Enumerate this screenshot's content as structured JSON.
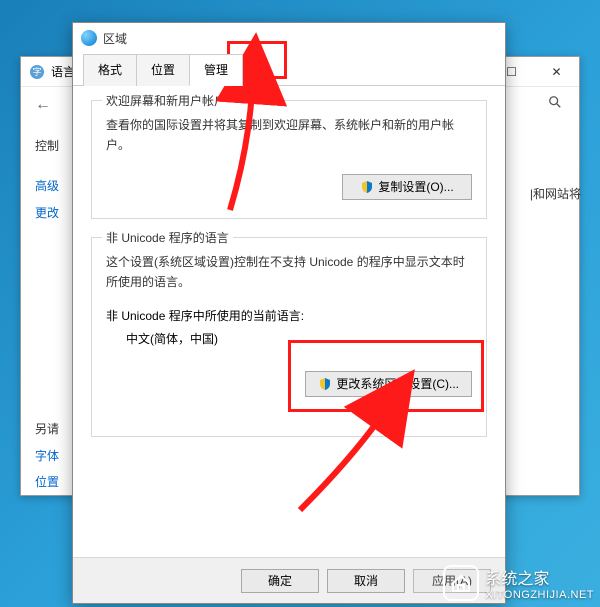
{
  "bg_window": {
    "title": "语言",
    "nav_back": "←",
    "nav_fwd": "→",
    "side_items": [
      "控制",
      "高级",
      "更改"
    ],
    "also_label": "另请",
    "also_links": [
      "字体",
      "位置"
    ],
    "right_hint": "|和网站将"
  },
  "dialog": {
    "title": "区域",
    "tabs": [
      "格式",
      "位置",
      "管理"
    ],
    "active_tab": 2,
    "group1": {
      "title": "欢迎屏幕和新用户帐户",
      "desc": "查看你的国际设置并将其复制到欢迎屏幕、系统帐户和新的用户帐户。",
      "button": "复制设置(O)..."
    },
    "group2": {
      "title": "非 Unicode 程序的语言",
      "desc": "这个设置(系统区域设置)控制在不支持 Unicode 的程序中显示文本时所使用的语言。",
      "current_label": "非 Unicode 程序中所使用的当前语言:",
      "current_value": "中文(简体，中国)",
      "button": "更改系统区域设置(C)..."
    },
    "buttons": {
      "ok": "确定",
      "cancel": "取消",
      "apply": "应用(A)"
    }
  },
  "watermark": {
    "name": "系统之家",
    "url": "XITONGZHIJIA.NET"
  }
}
